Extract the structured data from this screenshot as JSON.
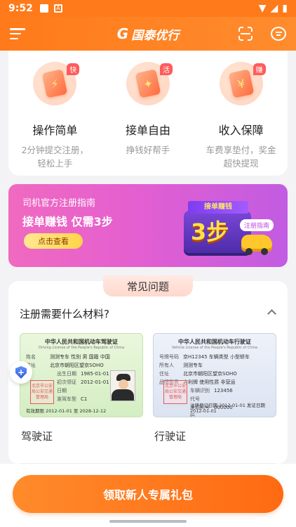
{
  "status_bar": {
    "time": "9:52"
  },
  "app_bar": {
    "logo_mark": "G",
    "logo_text": "国泰优行"
  },
  "features": [
    {
      "badge": "快",
      "title": "操作简单",
      "desc": "2分钟提交注册，轻松上手"
    },
    {
      "badge": "活",
      "title": "接单自由",
      "desc": "挣钱好帮手"
    },
    {
      "badge": "赚",
      "title": "收入保障",
      "desc": "车费享垫付，奖金超快提现"
    }
  ],
  "banner": {
    "title": "司机官方注册指南",
    "headline": "接单赚钱 仅需3步",
    "button": "点击查看",
    "art_ribbon": "接单赚钱",
    "art_big": "3步",
    "art_tag": "注册指南"
  },
  "faq": {
    "section_title": "常见问题",
    "question": "注册需要什么材料?",
    "driving_license": {
      "header": "中华人民共和国机动车驾驶证",
      "sub": "Driving License of the People's Republic of China",
      "rows": [
        {
          "k": "姓名",
          "v": "测测专车  性别 男  国籍 中国"
        },
        {
          "k": "住址",
          "v": "北京市朝阳区望京SOHO"
        },
        {
          "k": "出生日期",
          "v": "1985-01-01"
        },
        {
          "k": "初次领证日期",
          "v": "2012-01-01"
        },
        {
          "k": "准驾车型",
          "v": "C1"
        }
      ],
      "stamp": "北京市公安局公安交通管理局",
      "valid": "有效期限 2012-01-01 至 2028-12-12",
      "label": "驾驶证"
    },
    "vehicle_license": {
      "header": "中华人民共和国机动车行驶证",
      "sub": "Vehicle License of the People's Republic of China",
      "rows": [
        {
          "k": "号牌号码",
          "v": "京H12345  车辆类型 小型轿车"
        },
        {
          "k": "所有人",
          "v": "测测专车"
        },
        {
          "k": "住址",
          "v": "北京市朝阳区望京SOHO"
        },
        {
          "k": "品牌型号",
          "v": "吉利牌  使用性质 非营运"
        },
        {
          "k": "车辆识别代号",
          "v": "123456"
        },
        {
          "k": "发动机号码",
          "v": "000000"
        }
      ],
      "stamp": "北京市公安局公安交通管理局",
      "dates": "注册登记日期 2012-01-01  发证日期 2012-01-01",
      "label": "行驶证"
    }
  },
  "cta": {
    "label": "领取新人专属礼包"
  },
  "colors": {
    "brand_orange": "#ff7a1a",
    "banner_pink": "#e45fd0"
  }
}
